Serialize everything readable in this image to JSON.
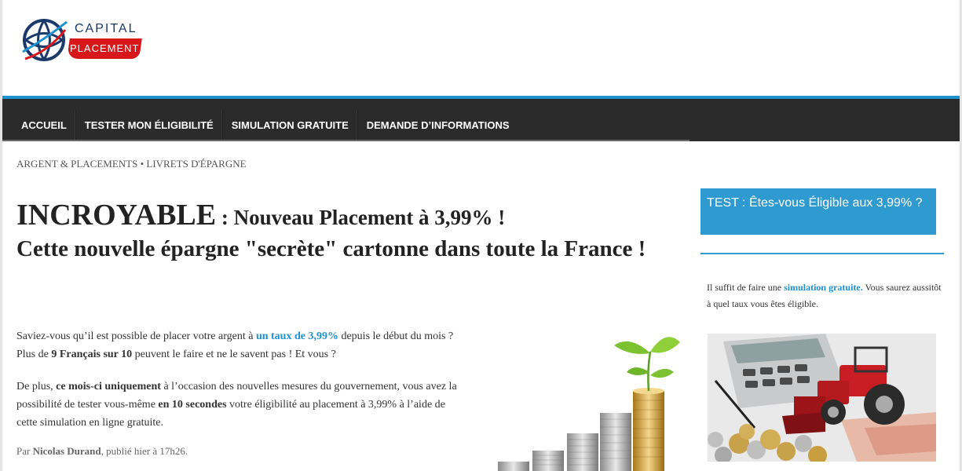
{
  "logo": {
    "line1": "CAPITAL",
    "line2": "PLACEMENT",
    "icon": "globe-icon"
  },
  "nav": {
    "items": [
      "ACCUEIL",
      "TESTER MON ÉLIGIBILITÉ",
      "SIMULATION GRATUITE",
      "DEMANDE D’INFORMATIONS"
    ]
  },
  "breadcrumb": "ARGENT & PLACEMENTS • LIVRETS D'ÉPARGNE",
  "article": {
    "title_big": "INCROYABLE",
    "title_rest": " : Nouveau Placement à 3,99% !",
    "title_sub": "Cette nouvelle épargne \"secrète\" cartonne dans toute la France !",
    "p1": {
      "a": "Saviez-vous qu’il est possible de placer votre argent à ",
      "link": "un taux de 3,99%",
      "b": " depuis le début du mois ? Plus de ",
      "bold": "9 Français sur 10",
      "c": " peuvent le faire et ne le savent pas ! Et vous ?"
    },
    "p2": {
      "a": "De plus, ",
      "bold1": "ce mois-ci uniquement",
      "b": " à l’occasion des nouvelles mesures du gouvernement, vous avez la possibilité de tester vous-même ",
      "bold2": "en 10 secondes",
      "c": " votre éligibilité au placement à 3,99% à l’aide de cette simulation en ligne gratuite."
    },
    "byline": {
      "prefix": "Par ",
      "author": "Nicolas Durand",
      "suffix": ", publié hier à 17h26."
    },
    "image": "coins-plant-image"
  },
  "sidebar": {
    "box_title": "TEST : Êtes-vous Éligible aux 3,99% ?",
    "text": {
      "a": "Il suffit de faire une ",
      "link": "simulation gratuite.",
      "b": " Vous saurez aussitôt à quel taux vous êtes éligible."
    },
    "image": "tractor-calculator-image"
  },
  "colors": {
    "accent": "#1e91d0",
    "nav_bg": "#2b2b2b",
    "logo_red": "#d8171b",
    "logo_navy": "#1b3a6b"
  }
}
